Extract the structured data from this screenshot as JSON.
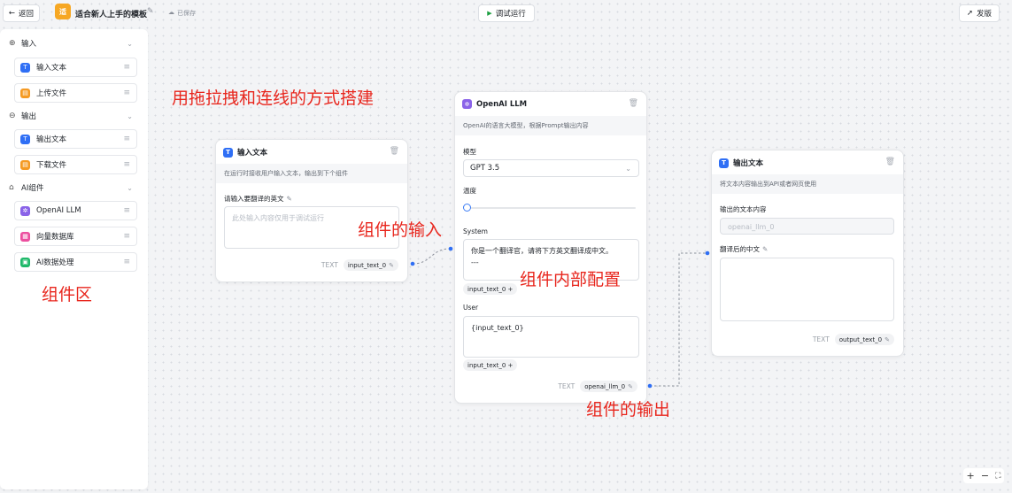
{
  "topbar": {
    "back_label": "返回",
    "app_logo_text": "适",
    "app_title": "适合新人上手的模板",
    "saved_status": "已保存",
    "run_label": "调试运行",
    "publish_label": "发版"
  },
  "sidebar": {
    "groups": [
      {
        "label": "输入",
        "items": [
          "输入文本",
          "上传文件"
        ]
      },
      {
        "label": "输出",
        "items": [
          "输出文本",
          "下载文件"
        ]
      },
      {
        "label": "AI组件",
        "items": [
          "OpenAI LLM",
          "向量数据库",
          "AI数据处理"
        ]
      }
    ]
  },
  "annotations": {
    "build_hint": "用拖拉拽和连线的方式搭建",
    "component_input": "组件的输入",
    "component_config": "组件内部配置",
    "component_output": "组件的输出",
    "component_area": "组件区"
  },
  "nodes": {
    "input_text": {
      "title": "输入文本",
      "description": "在运行时接收用户输入文本，输出到下个组件",
      "field_label": "请输入要翻译的英文",
      "placeholder": "此处输入内容仅用于调试运行",
      "out_type": "TEXT",
      "out_name": "input_text_0"
    },
    "openai_llm": {
      "title": "OpenAI LLM",
      "description": "OpenAI的语言大模型，根据Prompt输出内容",
      "model_label": "模型",
      "model_value": "GPT 3.5",
      "temperature_label": "温度",
      "temperature_value": 0,
      "system_label": "System",
      "system_text": "你是一个翻译官，请将下方英文翻译成中文。",
      "system_text_2": "---",
      "system_tag": "input_text_0 +",
      "user_label": "User",
      "user_text": "{input_text_0}",
      "user_tag": "input_text_0 +",
      "out_type": "TEXT",
      "out_name": "openai_llm_0"
    },
    "output_text": {
      "title": "输出文本",
      "description": "将文本内容输出到API或者网页使用",
      "content_label": "输出的文本内容",
      "content_value": "openai_llm_0",
      "field_label": "翻译后的中文",
      "out_type": "TEXT",
      "out_name": "output_text_0"
    }
  },
  "zoom": {
    "plus": "+",
    "minus": "−",
    "fit": "⛶"
  }
}
